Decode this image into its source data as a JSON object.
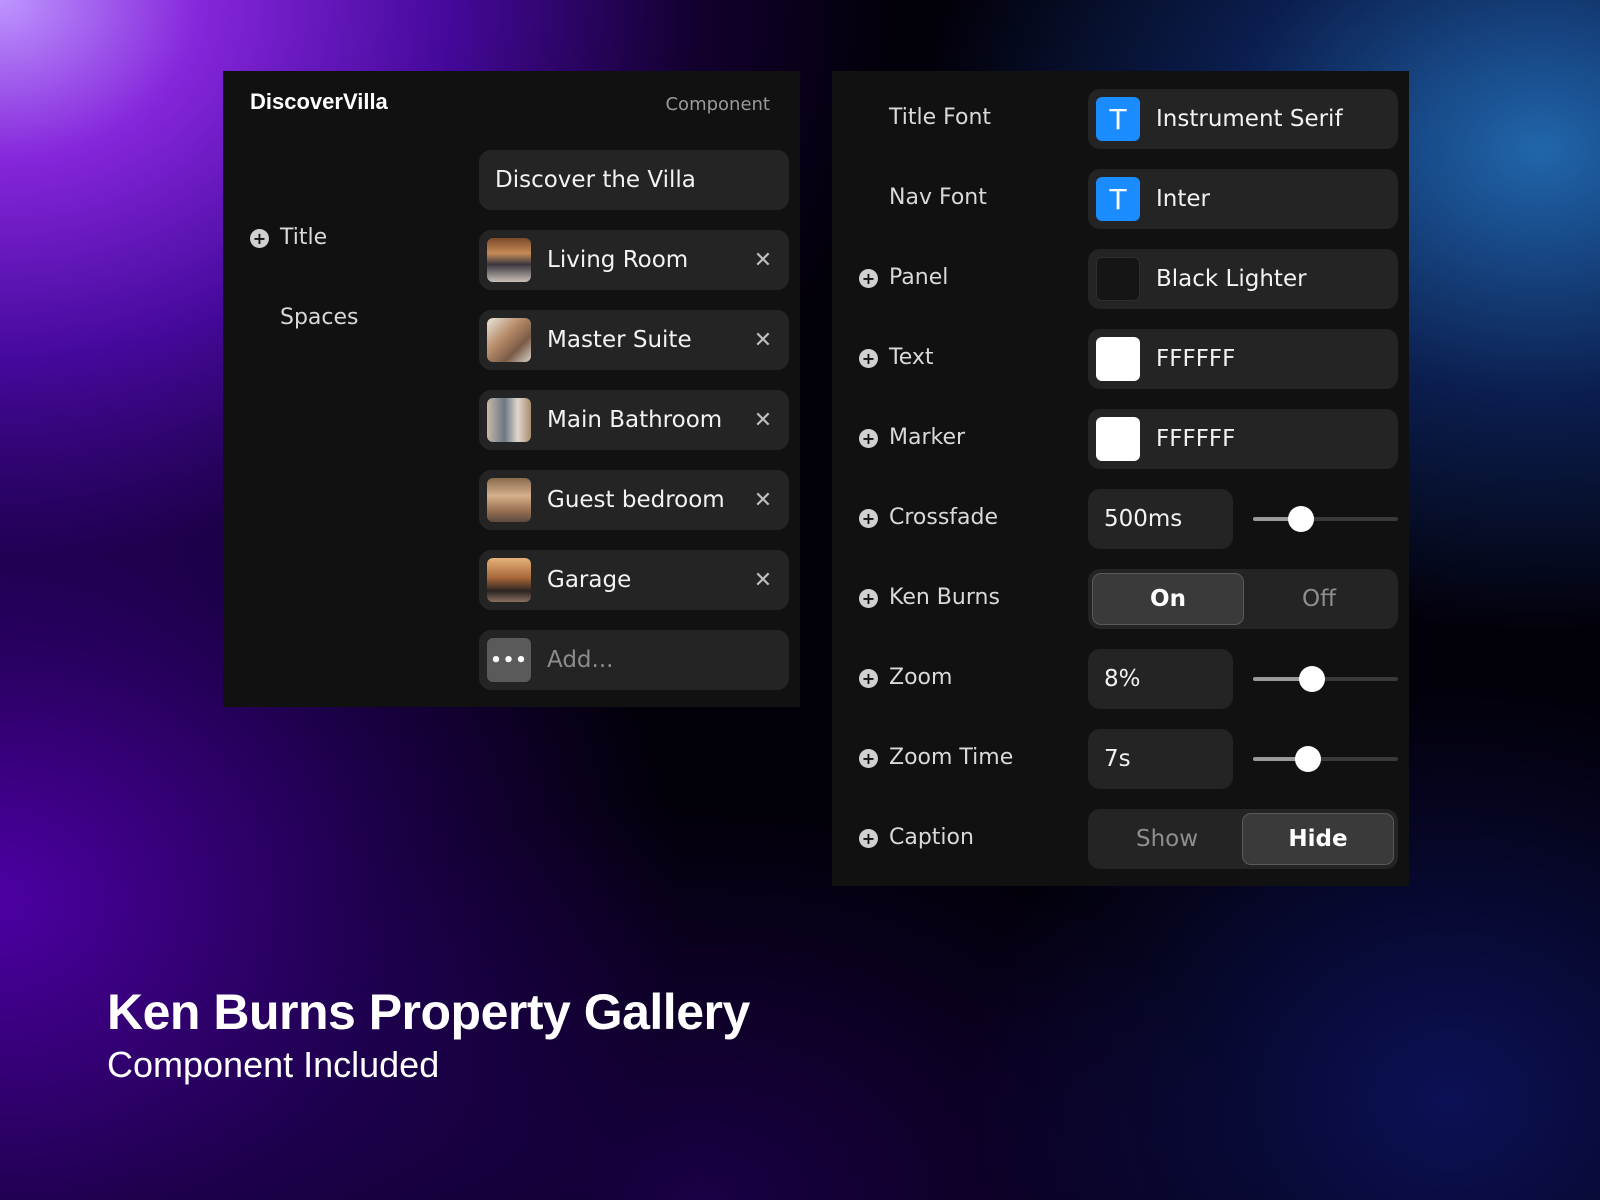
{
  "left_panel": {
    "brand": "DiscoverVilla",
    "tag": "Component",
    "title_label": "Title",
    "title_value": "Discover the Villa",
    "spaces_label": "Spaces",
    "spaces": [
      {
        "label": "Living Room"
      },
      {
        "label": "Master Suite"
      },
      {
        "label": "Main Bathroom"
      },
      {
        "label": "Guest bedroom"
      },
      {
        "label": "Garage"
      }
    ],
    "remove_glyph": "✕",
    "add_placeholder": "Add...",
    "add_glyph": "•••"
  },
  "right_panel": {
    "title_font": {
      "label": "Title Font",
      "value": "Instrument Serif",
      "badge": "T"
    },
    "nav_font": {
      "label": "Nav Font",
      "value": "Inter",
      "badge": "T"
    },
    "panel": {
      "label": "Panel",
      "value": "Black Lighter",
      "color": "#151515"
    },
    "text": {
      "label": "Text",
      "value": "FFFFFF",
      "color": "#FFFFFF"
    },
    "marker": {
      "label": "Marker",
      "value": "FFFFFF",
      "color": "#FFFFFF"
    },
    "crossfade": {
      "label": "Crossfade",
      "value": "500ms",
      "slider_fraction": 0.33
    },
    "ken_burns": {
      "label": "Ken Burns",
      "options": [
        "On",
        "Off"
      ],
      "selected": "On"
    },
    "zoom": {
      "label": "Zoom",
      "value": "8%",
      "slider_fraction": 0.41
    },
    "zoom_time": {
      "label": "Zoom Time",
      "value": "7s",
      "slider_fraction": 0.38
    },
    "caption": {
      "label": "Caption",
      "options": [
        "Show",
        "Hide"
      ],
      "selected": "Hide"
    }
  },
  "promo": {
    "headline": "Ken Burns Property Gallery",
    "subline": "Component Included"
  },
  "colors": {
    "panel_bg": "#111111",
    "field_bg": "#242424",
    "font_badge": "#1A8CFF"
  },
  "icons": {
    "plus": "plus-circle-icon",
    "remove": "close-icon",
    "more": "more-horizontal-icon",
    "font": "text-font-icon"
  }
}
